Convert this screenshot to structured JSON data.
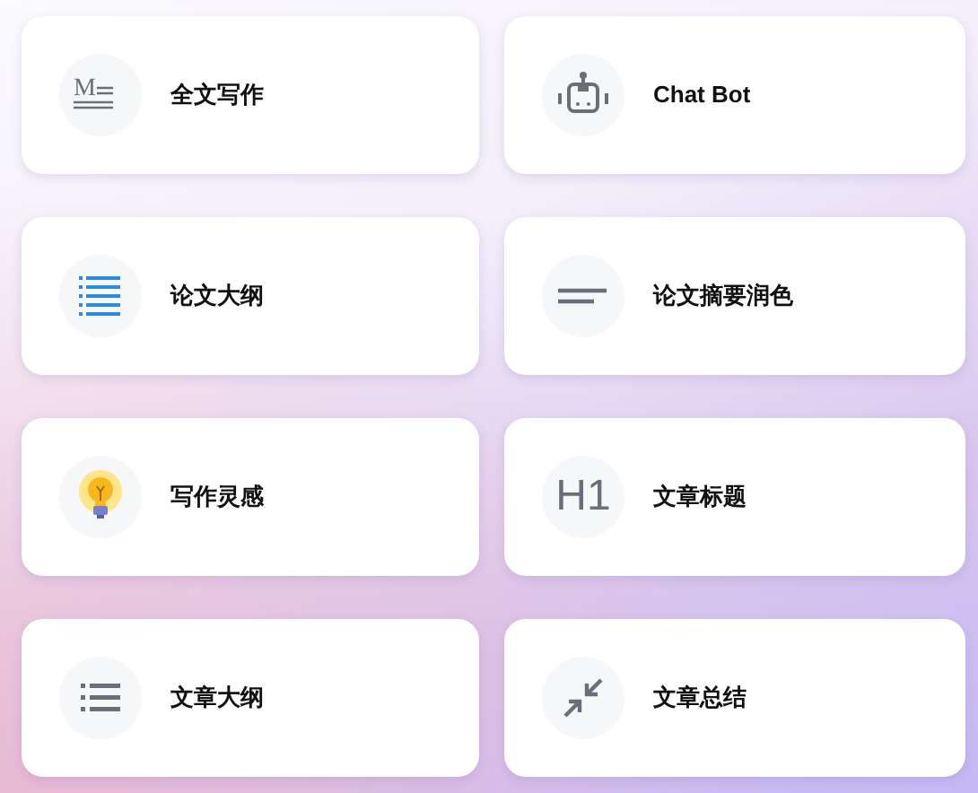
{
  "tools": [
    {
      "label": "全文写作",
      "kind": "markdown",
      "icon_text": "M"
    },
    {
      "label": "Chat Bot",
      "kind": "robot"
    },
    {
      "label": "论文大纲",
      "kind": "list-blue"
    },
    {
      "label": "论文摘要润色",
      "kind": "short-text"
    },
    {
      "label": "写作灵感",
      "kind": "bulb"
    },
    {
      "label": "文章标题",
      "kind": "heading",
      "icon_text": "H1"
    },
    {
      "label": "文章大纲",
      "kind": "list"
    },
    {
      "label": "文章总结",
      "kind": "compress"
    }
  ]
}
